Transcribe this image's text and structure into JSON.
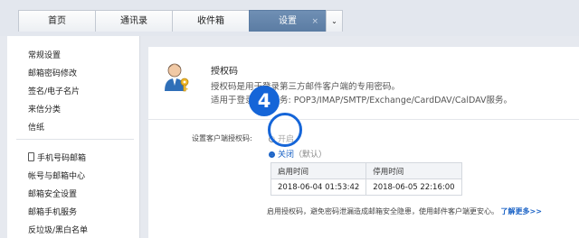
{
  "tabs": {
    "home": "首页",
    "contacts": "通讯录",
    "inbox": "收件箱",
    "settings": "设置",
    "close_glyph": "×",
    "dropdown_glyph": "⌄"
  },
  "sidebar": {
    "items": [
      "常规设置",
      "邮箱密码修改",
      "签名/电子名片",
      "来信分类",
      "信纸",
      "手机号码邮箱",
      "帐号与邮箱中心",
      "邮箱安全设置",
      "邮箱手机服务",
      "反垃圾/黑白名单"
    ]
  },
  "auth": {
    "icon": "user-key-icon",
    "title": "授权码",
    "desc1": "授权码是用于登录第三方邮件客户端的专用密码。",
    "desc2": "适用于登录以下服务: POP3/IMAP/SMTP/Exchange/CardDAV/CalDAV服务。",
    "setting_label": "设置客户端授权码:",
    "option_on": "开启",
    "option_off": "关闭",
    "option_off_default": "（默认）",
    "selected": "关闭",
    "table": {
      "headers": [
        "启用时间",
        "停用时间"
      ],
      "rows": [
        [
          "2018-06-04 01:53:42",
          "2018-06-05 22:16:00"
        ]
      ]
    },
    "footnote": "启用授权码，避免密码泄漏造成邮箱安全隐患，使用邮件客户端更安心。",
    "more_link": "了解更多>>"
  },
  "annotation": {
    "step_number": "4",
    "color": "#1565d8"
  },
  "colors": {
    "active_tab": "#5b7ca3",
    "link": "#1b63c6"
  }
}
